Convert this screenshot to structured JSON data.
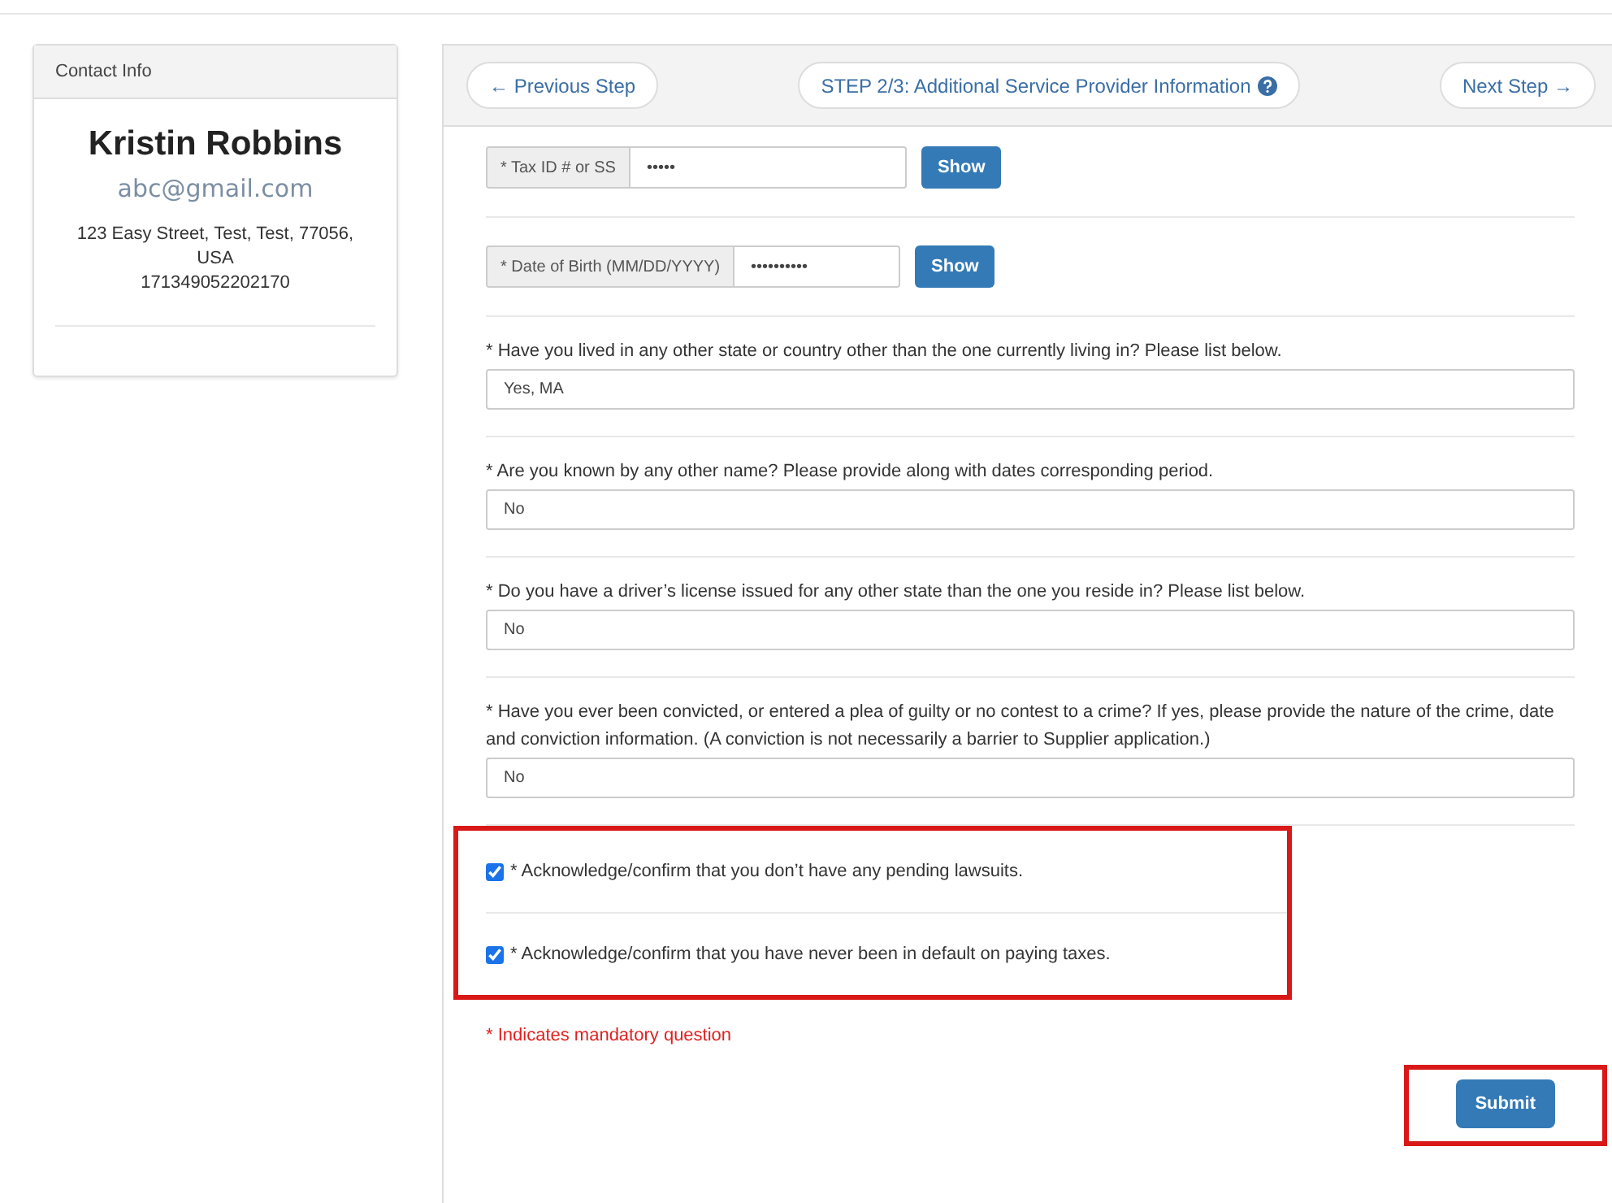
{
  "contact": {
    "title": "Contact Info",
    "name": "Kristin Robbins",
    "email": "abc@gmail.com",
    "address_lines": [
      "123 Easy Street, Test, Test, 77056,",
      "USA",
      "171349052202170"
    ]
  },
  "steps": {
    "previous": "← Previous Step",
    "current": "STEP 2/3: Additional Service Provider Information",
    "next": "Next Step →"
  },
  "secret_fields": [
    {
      "label": "* Tax ID # or SS",
      "value": "•••••",
      "button": "Show"
    },
    {
      "label": "* Date of Birth (MM/DD/YYYY)",
      "value": "••••••••••",
      "button": "Show"
    }
  ],
  "questions": [
    {
      "label": "* Have you lived in any other state or country other than the one currently living in? Please list below.",
      "value": "Yes, MA"
    },
    {
      "label": "* Are you known by any other name? Please provide along with dates corresponding period.",
      "value": "No"
    },
    {
      "label": "* Do you have a driver’s license issued for any other state than the one you reside in? Please list below.",
      "value": "No"
    },
    {
      "label": "* Have you ever been convicted, or entered a plea of guilty or no contest to a crime? If yes, please provide the nature of the crime, date and conviction information. (A conviction is not necessarily a barrier to Supplier application.)",
      "value": "No"
    }
  ],
  "acknowledgements": [
    {
      "label": "* Acknowledge/confirm that you don’t have any pending lawsuits.",
      "checked": true
    },
    {
      "label": "* Acknowledge/confirm that you have never been in default on paying taxes.",
      "checked": true
    }
  ],
  "note": "* Indicates mandatory question",
  "submit": "Submit"
}
